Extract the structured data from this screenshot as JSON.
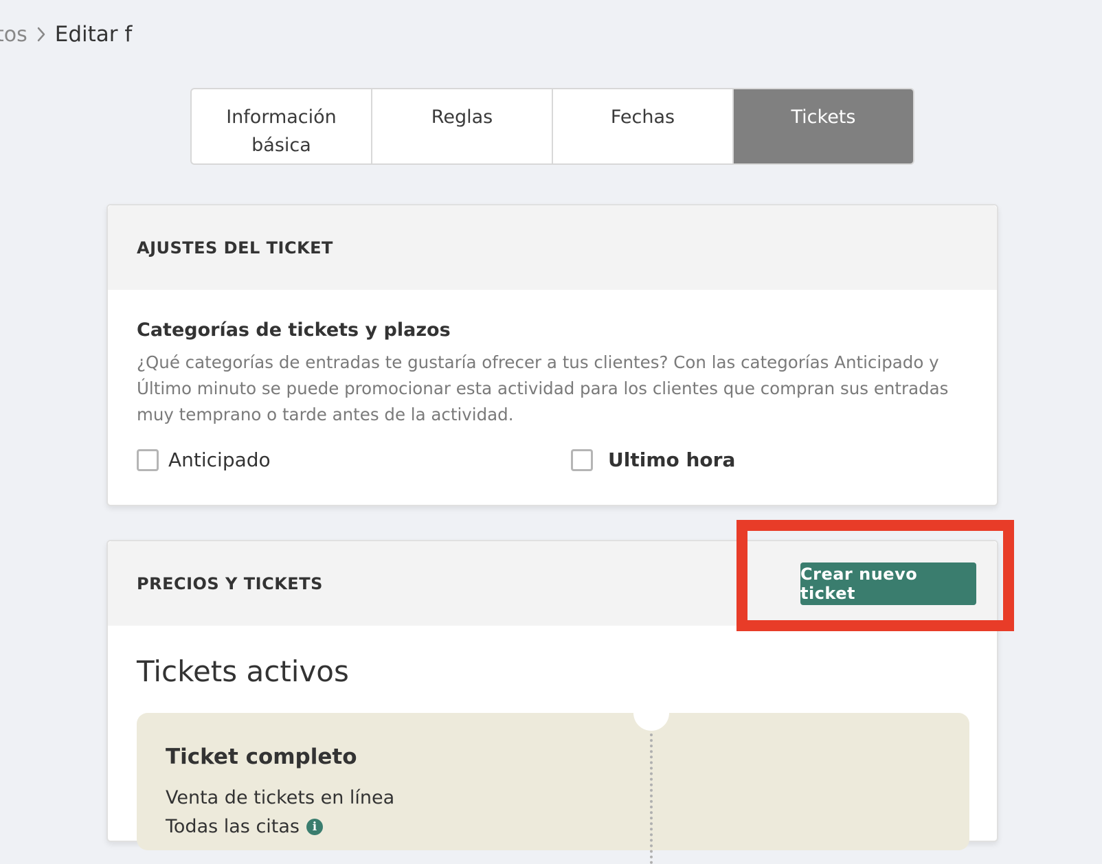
{
  "breadcrumb": {
    "previous": "tos",
    "current": "Editar f"
  },
  "tabs": [
    {
      "label": "Información básica",
      "active": false
    },
    {
      "label": "Reglas",
      "active": false
    },
    {
      "label": "Fechas",
      "active": false
    },
    {
      "label": "Tickets",
      "active": true
    }
  ],
  "ticket_settings": {
    "header": "AJUSTES DEL TICKET",
    "section_title": "Categorías de tickets y plazos",
    "description": "¿Qué categorías de entradas te gustaría ofrecer a tus clientes? Con las categorías Anticipado y Último minuto se puede promocionar esta actividad para los clientes que compran sus entradas muy temprano o tarde antes de la actividad.",
    "options": [
      {
        "label": "Anticipado",
        "checked": false
      },
      {
        "label": "Ultimo hora",
        "checked": false
      }
    ]
  },
  "prices": {
    "header": "PRECIOS Y TICKETS",
    "create_button": "Crear nuevo ticket",
    "active_title": "Tickets activos",
    "tickets": [
      {
        "name": "Ticket completo",
        "line1": "Venta de tickets en línea",
        "line2": "Todas las citas"
      }
    ]
  },
  "colors": {
    "accent": "#3a7d6e",
    "highlight": "#e83c28",
    "active_tab": "#808080",
    "ticket_bg": "#edeadb"
  },
  "icons": [
    "chevron-right-icon",
    "info-icon"
  ]
}
